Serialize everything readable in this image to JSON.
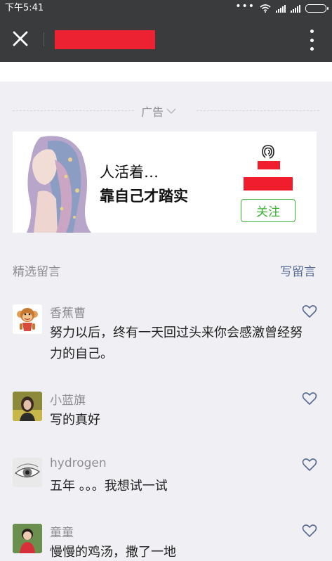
{
  "status_bar": {
    "time": "下午5:41",
    "icons": [
      "more-dots-icon",
      "wifi-icon",
      "signal-icon",
      "signal-icon",
      "battery-icon"
    ]
  },
  "header": {
    "close_icon": "close-icon",
    "more_icon": "more-vertical-icon"
  },
  "ad": {
    "label": "广告",
    "line1": "人活着…",
    "line2": "靠自己才踏实",
    "follow_label": "关注",
    "accent": "#3cb034"
  },
  "comments_section": {
    "title": "精选留言",
    "write_label": "写留言",
    "link_color": "#576b95",
    "items": [
      {
        "name": "香蕉曹",
        "text": "努力以后，终有一天回过头来你会感激曾经努力的自己。",
        "avatar": "monkey-avatar"
      },
      {
        "name": "小蓝旗",
        "text": "写的真好",
        "avatar": "photo-avatar"
      },
      {
        "name": "hydrogen",
        "text": "五年 。。。我想试一试",
        "avatar": "eye-sketch-avatar"
      },
      {
        "name": "童童",
        "text": "慢慢的鸡汤，撒了一地",
        "avatar": "child-photo-avatar"
      }
    ]
  }
}
